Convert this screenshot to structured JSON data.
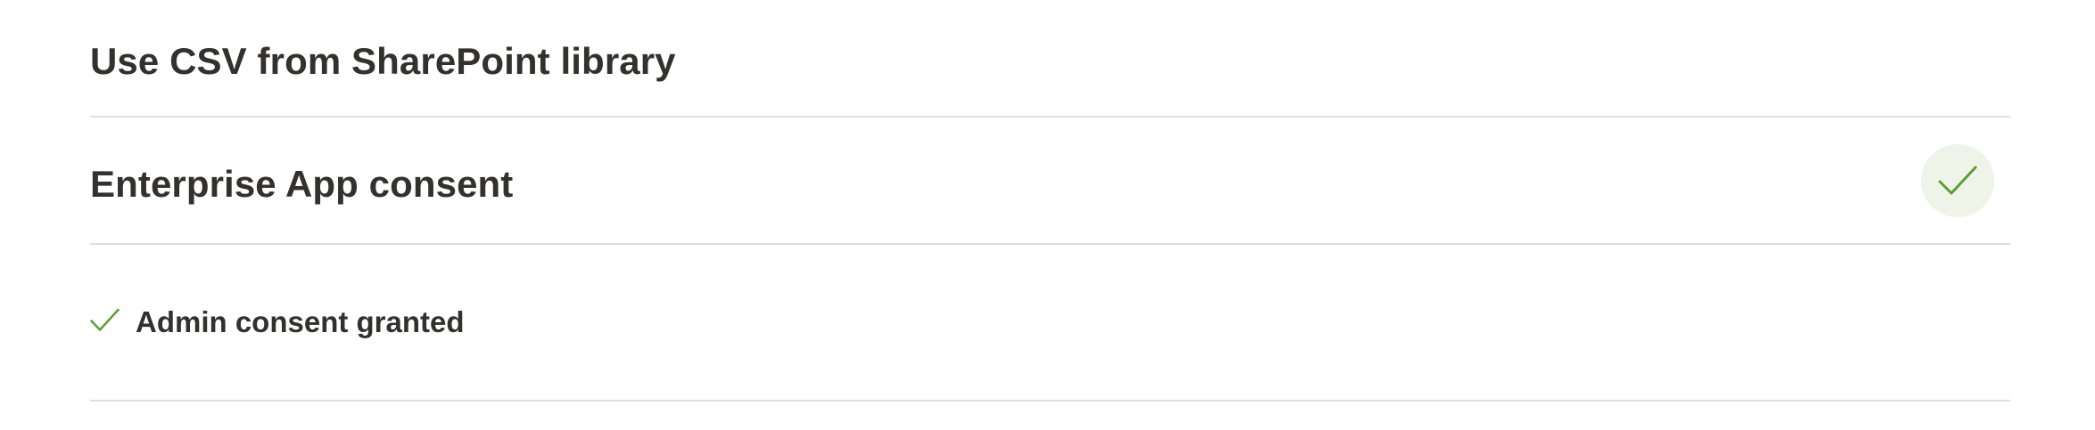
{
  "sections": [
    {
      "title": "Use CSV from SharePoint library"
    },
    {
      "title": "Enterprise App consent",
      "status_icon": "checkmark-circle-icon"
    }
  ],
  "consent_status": {
    "icon": "checkmark-icon",
    "text": "Admin consent granted"
  },
  "colors": {
    "success_green": "#5c9e31",
    "success_bg": "#eef4e8",
    "divider": "#e1dfdd",
    "text": "#323130"
  }
}
